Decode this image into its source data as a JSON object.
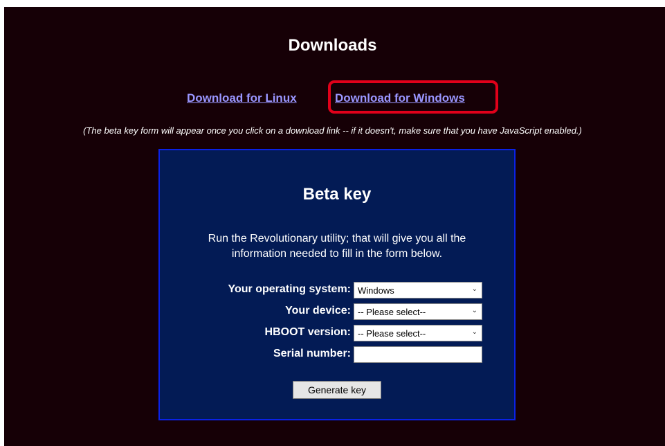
{
  "page": {
    "heading": "Downloads",
    "links": {
      "linux": "Download for Linux",
      "windows": "Download for Windows"
    },
    "hint": "(The beta key form will appear once you click on a download link -- if it doesn't, make sure that you have JavaScript enabled.)"
  },
  "beta": {
    "title": "Beta key",
    "description": "Run the Revolutionary utility; that will give you all the information needed to fill in the form below.",
    "fields": {
      "os": {
        "label": "Your operating system:",
        "value": "Windows"
      },
      "device": {
        "label": "Your device:",
        "value": "-- Please select--"
      },
      "hboot": {
        "label": "HBOOT version:",
        "value": "-- Please select--"
      },
      "serial": {
        "label": "Serial number:",
        "value": ""
      }
    },
    "button": "Generate key"
  },
  "colors": {
    "page_bg": "#160006",
    "panel_bg": "#031b55",
    "panel_border": "#0a22e6",
    "link": "#9a96ff",
    "highlight": "#e0001a"
  },
  "icons": {
    "dropdown": "chevron-down-icon"
  }
}
